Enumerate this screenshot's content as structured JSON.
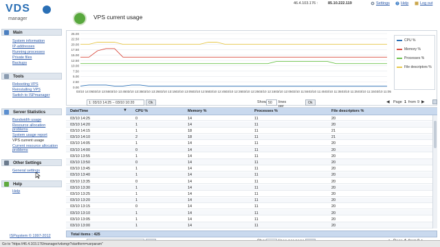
{
  "topbar": {
    "ip": "46.4.103.176 :",
    "ip_bold": "85.10.222.119",
    "settings": "Settings",
    "help": "Help",
    "logout": "Log out"
  },
  "logo": {
    "brand": "VDS",
    "sub": "manager"
  },
  "sidebar": {
    "main": {
      "title": "Main",
      "items": [
        "System information",
        "IP-addresses",
        "Running processes",
        "Private files",
        "Backups"
      ]
    },
    "tools": {
      "title": "Tools",
      "items": [
        "Rebooting VPS",
        "Reinstalling VPS",
        "Switch to ISPmanager"
      ]
    },
    "stats": {
      "title": "Server Statistics",
      "items": [
        "Bandwidth usage",
        "Resource allocation",
        "problems",
        "System usage report",
        "VPS current usage",
        "Current resource allocation",
        "problems"
      ]
    },
    "other": {
      "title": "Other Settings",
      "items": [
        "General settings"
      ]
    },
    "help": {
      "title": "Help",
      "items": [
        "Help"
      ]
    },
    "copyright": "ISPsystem © 1997-2012"
  },
  "page": {
    "title": "VPS current usage"
  },
  "chart_data": {
    "type": "line",
    "categories": [
      "03/10 14:05",
      "03/10 13:55",
      "03/10 13:45",
      "03/10 13:35",
      "03/10 13:25",
      "03/10 13:15",
      "03/10 13:05",
      "03/10 12:55",
      "03/10 12:45",
      "03/10 12:35",
      "03/10 12:25",
      "03/10 12:15",
      "03/10 12:05",
      "03/10 11:55",
      "03/10 11:45",
      "03/10 11:35",
      "03/10 11:25",
      "03/10 11:15",
      "03/10 11:05"
    ],
    "yticks": [
      "25.00",
      "22.50",
      "20.00",
      "17.50",
      "15.00",
      "12.50",
      "10.00",
      "7.50",
      "5.00",
      "2.50",
      "0.00"
    ],
    "ylim": [
      0,
      25
    ],
    "legend": [
      "CPU %",
      "Memory %",
      "Processes %",
      "File descriptors %"
    ],
    "series": [
      {
        "name": "CPU %",
        "color": "#2a6fb5",
        "values": [
          0.5,
          1,
          1,
          1,
          0.5,
          0.5,
          1,
          1,
          0.5,
          0.5,
          0.5,
          0.5,
          0.5,
          0.5,
          0.5,
          0.5,
          0.5,
          0.5,
          0.5,
          0.5,
          0.5,
          0.5,
          0.5,
          0.5,
          0.5,
          0.5,
          0.5,
          0.5,
          0.5,
          0.5,
          0.5,
          0.5,
          0.5,
          0.5,
          0.5,
          0.5,
          0.5
        ]
      },
      {
        "name": "Memory %",
        "color": "#d9483b",
        "values": [
          14,
          14,
          17,
          18,
          18,
          14,
          14,
          14,
          14,
          14,
          14,
          14,
          14,
          14,
          14,
          14,
          14,
          14,
          14,
          14,
          14,
          14,
          14,
          14,
          14,
          14,
          14,
          14,
          14,
          14,
          14,
          14,
          14,
          14,
          14,
          14,
          14
        ]
      },
      {
        "name": "Processes %",
        "color": "#6cc24a",
        "values": [
          11,
          11,
          11,
          11,
          11,
          11,
          11,
          11,
          11,
          11,
          11,
          11,
          11,
          11,
          11,
          11,
          11,
          11,
          11,
          11,
          11,
          11,
          11,
          12,
          12,
          12,
          12,
          12,
          12,
          12,
          11,
          11,
          11,
          11,
          11,
          11,
          11
        ]
      },
      {
        "name": "File descriptors %",
        "color": "#e8c84a",
        "values": [
          20,
          20,
          21,
          21,
          21,
          20,
          20,
          20,
          20,
          20,
          20,
          20,
          20,
          20,
          20,
          21,
          21,
          20,
          20,
          20,
          20,
          20,
          20,
          20,
          20,
          20,
          20,
          20,
          20,
          20,
          20,
          20,
          20,
          20,
          20,
          20,
          20
        ]
      }
    ]
  },
  "controls": {
    "range": "1: 03/10 14:25 – 03/10 10:20",
    "ok": "Ok",
    "show": "Show",
    "per_page_value": "50",
    "lines_per_page": "lines per page",
    "page_label": "Page",
    "page_num": "1",
    "page_of": "from",
    "page_total": "9"
  },
  "table": {
    "headers": [
      "Date/Time",
      "CPU %",
      "Memory %",
      "Processes %",
      "File descriptors %"
    ],
    "rows": [
      [
        "03/10 14:25",
        "0",
        "14",
        "11",
        "20"
      ],
      [
        "03/10 14:20",
        "1",
        "14",
        "11",
        "20"
      ],
      [
        "03/10 14:15",
        "1",
        "18",
        "11",
        "21"
      ],
      [
        "03/10 14:10",
        "2",
        "18",
        "11",
        "21"
      ],
      [
        "03/10 14:05",
        "1",
        "14",
        "11",
        "20"
      ],
      [
        "03/10 14:00",
        "0",
        "14",
        "11",
        "20"
      ],
      [
        "03/10 13:55",
        "1",
        "14",
        "11",
        "20"
      ],
      [
        "03/10 13:50",
        "0",
        "14",
        "11",
        "20"
      ],
      [
        "03/10 13:45",
        "1",
        "14",
        "11",
        "20"
      ],
      [
        "03/10 13:40",
        "1",
        "14",
        "11",
        "20"
      ],
      [
        "03/10 13:35",
        "0",
        "14",
        "11",
        "20"
      ],
      [
        "03/10 13:30",
        "1",
        "14",
        "11",
        "20"
      ],
      [
        "03/10 13:25",
        "1",
        "14",
        "11",
        "20"
      ],
      [
        "03/10 13:20",
        "1",
        "14",
        "11",
        "20"
      ],
      [
        "03/10 13:15",
        "0",
        "14",
        "11",
        "20"
      ],
      [
        "03/10 13:10",
        "1",
        "14",
        "11",
        "20"
      ],
      [
        "03/10 13:05",
        "1",
        "14",
        "11",
        "20"
      ],
      [
        "03/10 13:00",
        "1",
        "14",
        "11",
        "20"
      ]
    ],
    "total": "Total items : 425"
  },
  "statusbar": "Go to \"https://46.4.103.176/manager/vdsmgr?startform=usrparam\""
}
